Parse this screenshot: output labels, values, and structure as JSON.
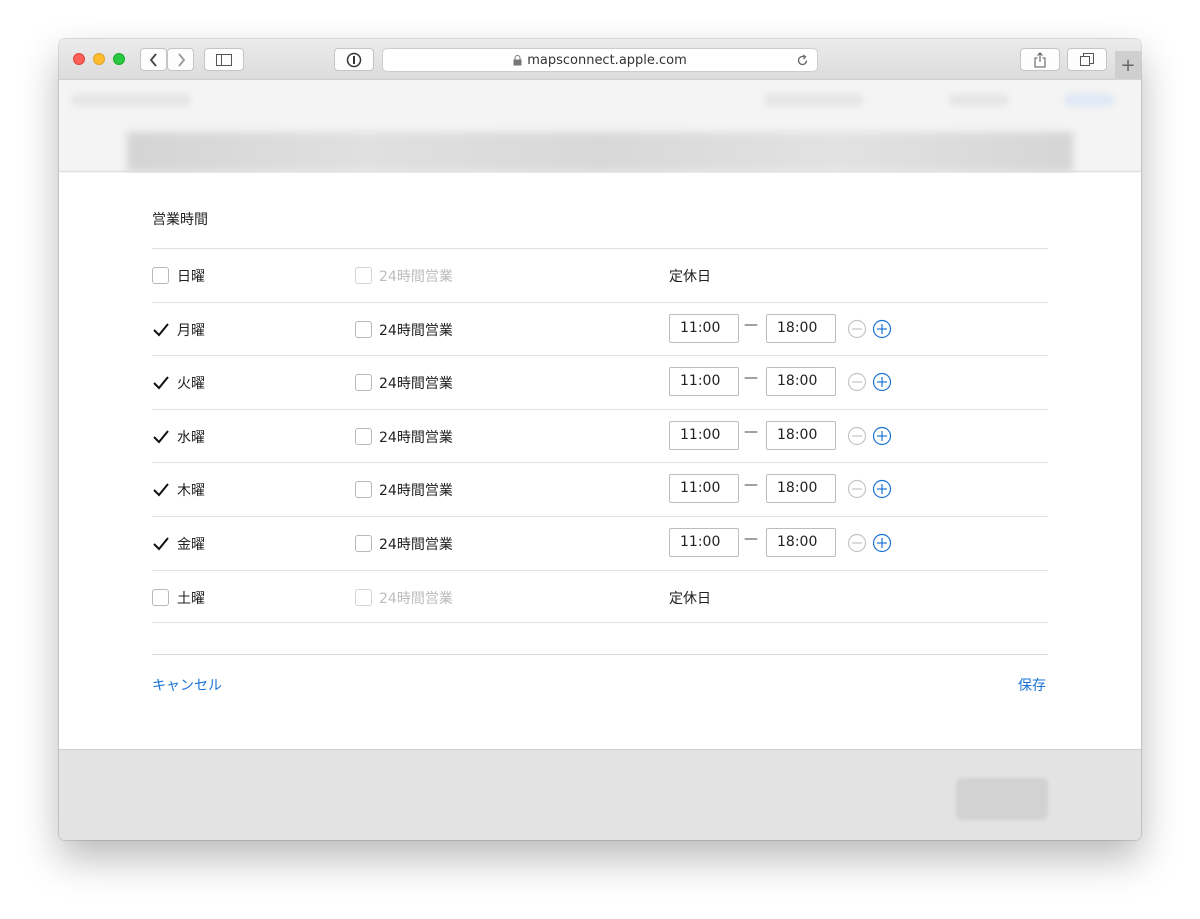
{
  "browser": {
    "url": "mapsconnect.apple.com"
  },
  "form": {
    "title": "営業時間",
    "all_day_label": "24時間営業",
    "closed_label": "定休日",
    "dash": "—",
    "days": [
      {
        "day": "日曜",
        "checked": false,
        "all_day_enabled": false,
        "open": null,
        "close": null
      },
      {
        "day": "月曜",
        "checked": true,
        "all_day_enabled": true,
        "open": "11:00",
        "close": "18:00"
      },
      {
        "day": "火曜",
        "checked": true,
        "all_day_enabled": true,
        "open": "11:00",
        "close": "18:00"
      },
      {
        "day": "水曜",
        "checked": true,
        "all_day_enabled": true,
        "open": "11:00",
        "close": "18:00"
      },
      {
        "day": "木曜",
        "checked": true,
        "all_day_enabled": true,
        "open": "11:00",
        "close": "18:00"
      },
      {
        "day": "金曜",
        "checked": true,
        "all_day_enabled": true,
        "open": "11:00",
        "close": "18:00"
      },
      {
        "day": "土曜",
        "checked": false,
        "all_day_enabled": false,
        "open": null,
        "close": null
      }
    ],
    "cancel_label": "キャンセル",
    "save_label": "保存"
  },
  "colors": {
    "link": "#1a73d6",
    "remove_icon": "#c4c4c4",
    "add_icon": "#1a73d6"
  }
}
